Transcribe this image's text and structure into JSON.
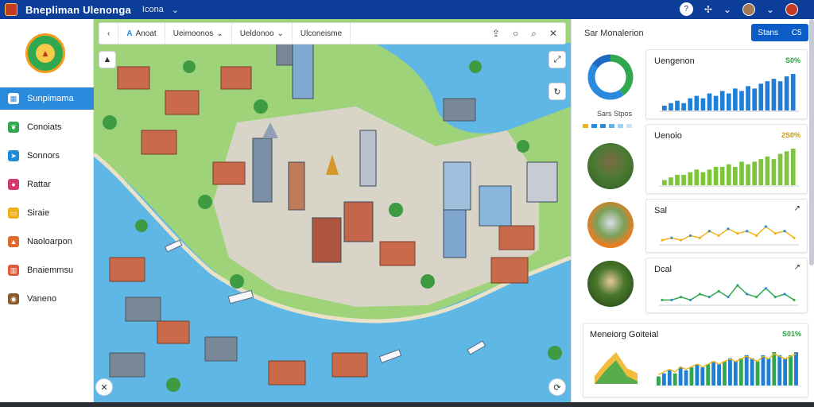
{
  "app": {
    "title": "Bnepliman Ulenonga",
    "view_label": "Icona",
    "colors": {
      "topbar": "#0c3d98",
      "accent": "#2a8bdc",
      "primary_button": "#0c5cc7"
    }
  },
  "topbar_icons": [
    "help-circle-icon",
    "settings-icon",
    "chevron-down-icon",
    "avatar",
    "chevron-down-icon",
    "notification-avatar"
  ],
  "sidebar": {
    "items": [
      {
        "label": "Sunpimama",
        "icon": "grid-icon",
        "color": "#2a8bdc",
        "active": true
      },
      {
        "label": "Conoiats",
        "icon": "leaf-icon",
        "color": "#2fa84f",
        "active": false
      },
      {
        "label": "Sonnors",
        "icon": "paper-plane-icon",
        "color": "#1f8bd6",
        "active": false
      },
      {
        "label": "Rattar",
        "icon": "pin-icon",
        "color": "#d63a6a",
        "active": false
      },
      {
        "label": "Siraie",
        "icon": "folder-icon",
        "color": "#f0b21c",
        "active": false
      },
      {
        "label": "Naoloarpon",
        "icon": "temple-icon",
        "color": "#e06a2b",
        "active": false
      },
      {
        "label": "Bnaiemmsu",
        "icon": "building-icon",
        "color": "#e0573b",
        "active": false
      },
      {
        "label": "Vaneno",
        "icon": "compass-icon",
        "color": "#8a5a2d",
        "active": false
      }
    ]
  },
  "map_toolbar": {
    "back_icon": "chevron-left-icon",
    "brand": "Anoat",
    "dropdown_1": "Ueimoonos",
    "dropdown_2": "Ueldonoo",
    "dropdown_3": "Ulconeisme",
    "tools": [
      "export-icon",
      "circle-icon",
      "search-icon",
      "close-icon"
    ]
  },
  "panel": {
    "title": "Sar Monalerion",
    "button_label": "Stans",
    "button_icon_label": "C5",
    "donut_label": "Sars Stpos",
    "donut_values": [
      40,
      45,
      15
    ],
    "donut_colors": [
      "#2fa84f",
      "#2a8bdc",
      "#1f6bc2"
    ],
    "legend_colors": [
      "#f0b21c",
      "#2a8bdc",
      "#2a8bdc",
      "#5fb3e8",
      "#9fd0f0",
      "#c9e3f5"
    ],
    "cards": [
      {
        "title": "Uengenon",
        "value": "S0%",
        "value_color": "#22a33b",
        "type": "bar",
        "color": "#1f7fd6",
        "values": [
          2,
          3,
          4,
          3,
          5,
          6,
          5,
          7,
          6,
          8,
          7,
          9,
          8,
          10,
          9,
          11,
          12,
          13,
          12,
          14,
          15
        ]
      },
      {
        "title": "Uenoio",
        "value": "2S0%",
        "value_color": "#c99a10",
        "type": "bar",
        "color": "#7cc63a",
        "values": [
          2,
          3,
          4,
          4,
          5,
          6,
          5,
          6,
          7,
          7,
          8,
          7,
          9,
          8,
          9,
          10,
          11,
          10,
          12,
          13,
          14
        ]
      },
      {
        "title": "Sal",
        "value": "",
        "type": "line",
        "color": "#f0b21c",
        "values": [
          1,
          2,
          1,
          3,
          2,
          5,
          3,
          6,
          4,
          5,
          3,
          7,
          4,
          5,
          2
        ]
      },
      {
        "title": "Dcal",
        "value": "",
        "type": "line",
        "color": "#2fa84f",
        "values": [
          1,
          1,
          2,
          1,
          3,
          2,
          4,
          2,
          6,
          3,
          2,
          5,
          2,
          3,
          1
        ]
      }
    ],
    "wide_card": {
      "title": "Meneiorg Goiteial",
      "value": "S01%",
      "mini_values": [
        3,
        8,
        12,
        6,
        4
      ],
      "values": [
        3,
        4,
        5,
        4,
        6,
        5,
        6,
        7,
        6,
        7,
        8,
        7,
        8,
        9,
        8,
        9,
        10,
        9,
        8,
        10,
        9,
        11,
        10,
        9,
        10,
        11
      ]
    }
  },
  "map_buttons": [
    "mountain-icon",
    "expand-icon",
    "refresh-icon",
    "compass-icon",
    "locate-icon"
  ]
}
